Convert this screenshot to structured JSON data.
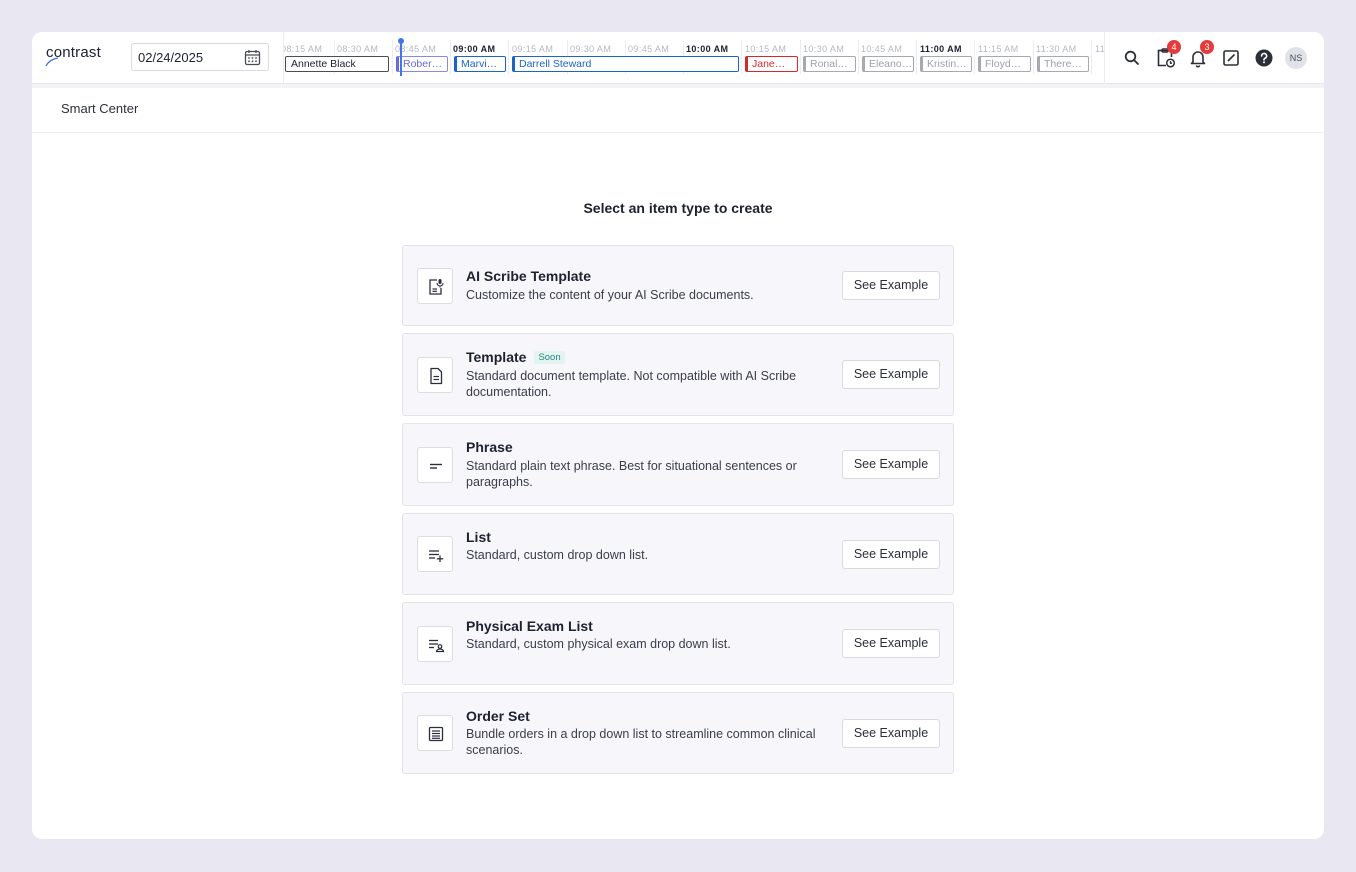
{
  "app": {
    "logo": "contrast"
  },
  "header": {
    "date_value": "02/24/2025",
    "timeline_ticks": [
      "08:15 AM",
      "08:30 AM",
      "08:45 AM",
      "09:00 AM",
      "09:15 AM",
      "09:30 AM",
      "09:45 AM",
      "10:00 AM",
      "10:15 AM",
      "10:30 AM",
      "10:45 AM",
      "11:00 AM",
      "11:15 AM",
      "11:30 AM",
      "11"
    ],
    "appointments": [
      "Annette Black",
      "Rober…",
      "Marvi…",
      "Darrell Steward",
      "Jane…",
      "Ronal…",
      "Eleano…",
      "Kristin…",
      "Floyd…",
      "There…"
    ],
    "icons": [
      "search-icon",
      "clipboard-clock-icon",
      "bell-icon",
      "edit-square-icon",
      "help-icon"
    ],
    "tasks_badge": "4",
    "notifications_badge": "3",
    "avatar_initials": "NS"
  },
  "breadcrumb": {
    "current": "Smart Center"
  },
  "main": {
    "heading": "Select an item type to create",
    "soon_label": "Soon",
    "items": [
      {
        "title": "AI Scribe Template",
        "description": "Customize the content of your AI Scribe documents.",
        "button": "See Example",
        "icon": "ai-scribe-document-icon"
      },
      {
        "title": "Template",
        "description": "Standard document template. Not compatible with AI Scribe documentation.",
        "button": "See Example",
        "icon": "document-icon"
      },
      {
        "title": "Phrase",
        "description": "Standard plain text phrase. Best for situational sentences or paragraphs.",
        "button": "See Example",
        "icon": "short-text-icon"
      },
      {
        "title": "List",
        "description": "Standard, custom drop down list.",
        "button": "See Example",
        "icon": "playlist-add-icon"
      },
      {
        "title": "Physical Exam List",
        "description": "Standard, custom physical exam drop down list.",
        "button": "See Example",
        "icon": "list-person-icon"
      },
      {
        "title": "Order Set",
        "description": "Bundle orders in a drop down list to streamline common clinical scenarios.",
        "button": "See Example",
        "icon": "order-list-icon"
      }
    ]
  }
}
